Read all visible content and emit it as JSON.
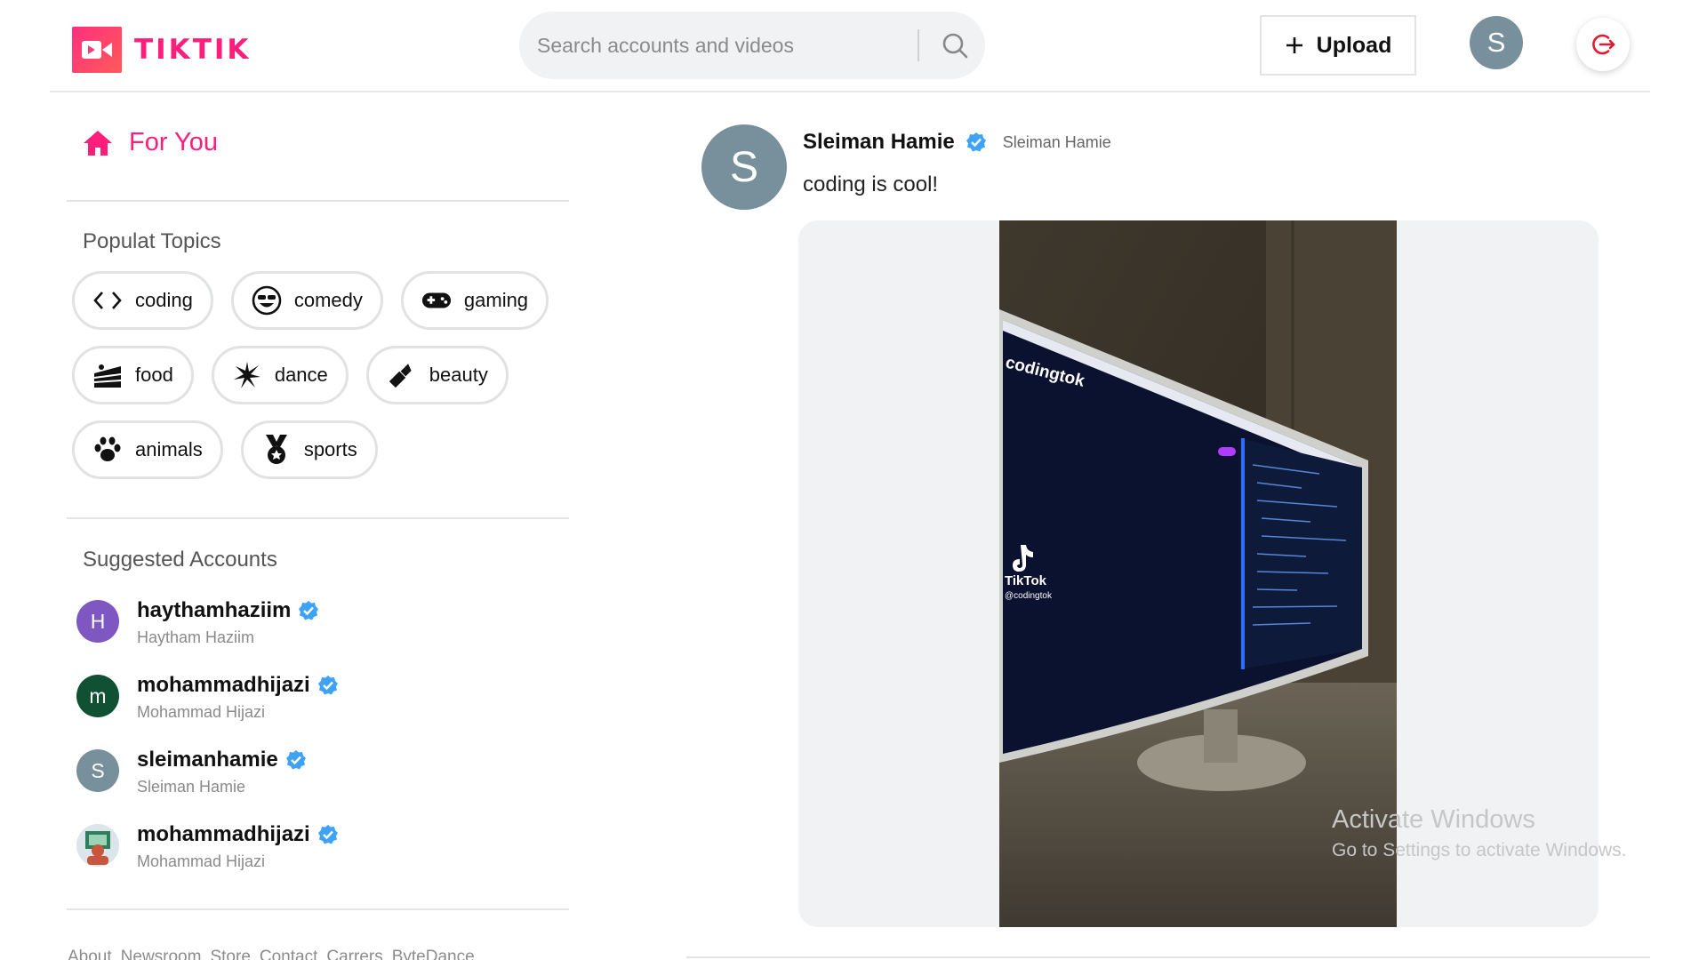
{
  "app": {
    "name": "TIKTIK",
    "brand_color": "#ff1e7a"
  },
  "header": {
    "search_placeholder": "Search accounts and videos",
    "upload_label": "Upload",
    "user_initial": "S"
  },
  "sidebar": {
    "for_you_label": "For You",
    "topics_title": "Populat Topics",
    "topics": [
      {
        "label": "coding",
        "icon": "code-icon"
      },
      {
        "label": "comedy",
        "icon": "laughing-face-icon"
      },
      {
        "label": "gaming",
        "icon": "gamepad-icon"
      },
      {
        "label": "food",
        "icon": "cake-icon"
      },
      {
        "label": "dance",
        "icon": "dance-burst-icon"
      },
      {
        "label": "beauty",
        "icon": "lipstick-icon"
      },
      {
        "label": "animals",
        "icon": "paw-icon"
      },
      {
        "label": "sports",
        "icon": "medal-icon"
      }
    ],
    "accounts_title": "Suggested Accounts",
    "accounts": [
      {
        "username": "haythamhaziim",
        "name": "Haytham Haziim",
        "initial": "H",
        "color": "#7e57c2"
      },
      {
        "username": "mohammadhijazi",
        "name": "Mohammad Hijazi",
        "initial": "m",
        "color": "#0f5132"
      },
      {
        "username": "sleimanhamie",
        "name": "Sleiman Hamie",
        "initial": "S",
        "color": "#78909c"
      },
      {
        "username": "mohammadhijazi",
        "name": "Mohammad Hijazi",
        "initial": "",
        "color": "#e9eef2"
      }
    ],
    "footer_links": [
      "About",
      "Newsroom",
      "Store",
      "Contact",
      "Carrers",
      "ByteDance"
    ]
  },
  "post": {
    "author_initial": "S",
    "author_display": "Sleiman Hamie",
    "author_name": "Sleiman Hamie",
    "caption": "coding is cool!",
    "video_overlay_text": "codingtok",
    "watermark_brand": "TikTok",
    "watermark_handle": "@codingtok"
  },
  "os_notice": {
    "line1": "Activate Windows",
    "line2": "Go to Settings to activate Windows."
  }
}
